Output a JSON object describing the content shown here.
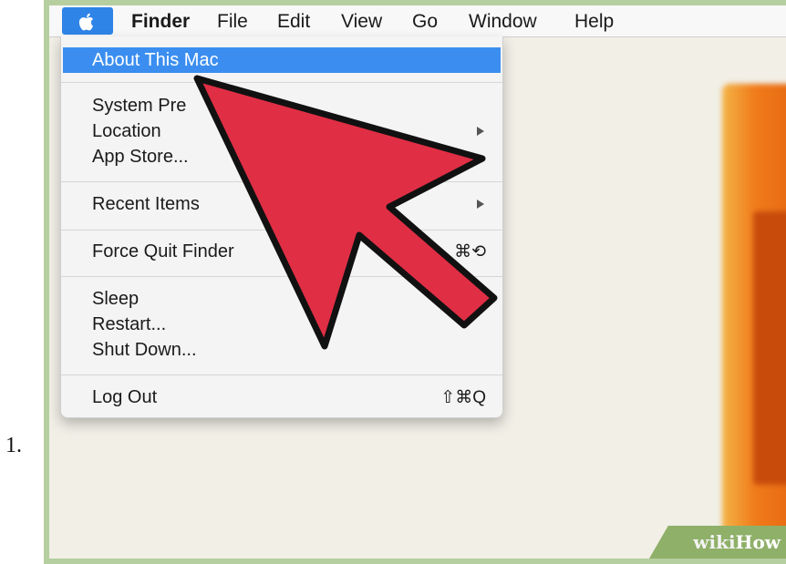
{
  "step_number": "1.",
  "menubar": {
    "apple_icon": "apple-icon",
    "items": [
      "Finder",
      "File",
      "Edit",
      "View",
      "Go",
      "Window",
      "Help"
    ]
  },
  "apple_menu": {
    "about": "About This Mac",
    "system_prefs": "System Pre",
    "location": "Location",
    "app_store": "App Store...",
    "recent_items": "Recent Items",
    "force_quit": "Force Quit Finder",
    "force_quit_shortcut": "⌘⟲",
    "sleep": "Sleep",
    "restart": "Restart...",
    "shut_down": "Shut Down...",
    "log_out": "Log Out",
    "log_out_shortcut": "⇧⌘Q"
  },
  "annotation": {
    "cursor_icon": "red-arrow-cursor-icon",
    "color": "#e02e45"
  },
  "watermark": {
    "part1": "wiki",
    "part2": "How"
  },
  "colors": {
    "highlight": "#3b8ef0",
    "frame": "#b6cfa0"
  }
}
